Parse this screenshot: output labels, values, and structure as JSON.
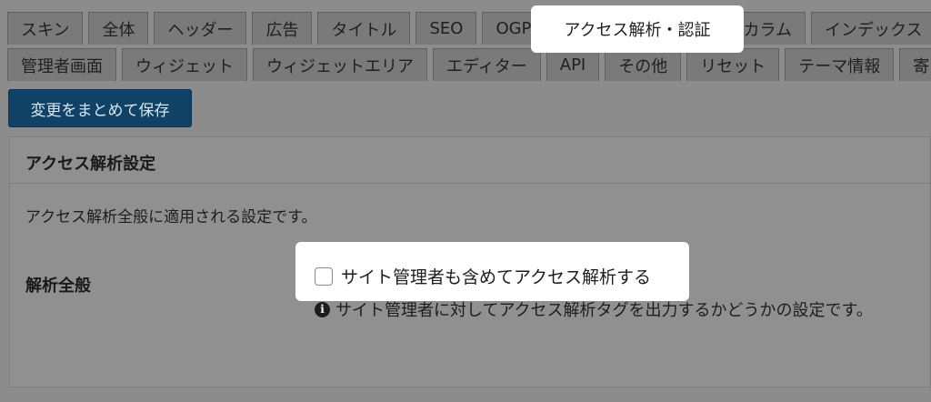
{
  "tabs_row1": [
    {
      "label": "スキン"
    },
    {
      "label": "全体"
    },
    {
      "label": "ヘッダー"
    },
    {
      "label": "広告"
    },
    {
      "label": "タイトル"
    },
    {
      "label": "SEO"
    },
    {
      "label": "OGP"
    },
    {
      "label": "アクセス解析・認証",
      "active": true
    },
    {
      "label": "カラム"
    },
    {
      "label": "インデックス"
    }
  ],
  "tabs_row2": [
    {
      "label": "管理者画面"
    },
    {
      "label": "ウィジェット"
    },
    {
      "label": "ウィジェットエリア"
    },
    {
      "label": "エディター"
    },
    {
      "label": "API"
    },
    {
      "label": "その他"
    },
    {
      "label": "リセット"
    },
    {
      "label": "テーマ情報"
    },
    {
      "label": "寄"
    }
  ],
  "save_button": {
    "label": "変更をまとめて保存"
  },
  "section": {
    "title": "アクセス解析設定",
    "description": "アクセス解析全般に適用される設定です。"
  },
  "field": {
    "label": "解析全般",
    "checkbox_label": "サイト管理者も含めてアクセス解析する",
    "checked": false,
    "help_icon": "info-icon",
    "help_text": "サイト管理者に対してアクセス解析タグを出力するかどうかの設定です。"
  }
}
